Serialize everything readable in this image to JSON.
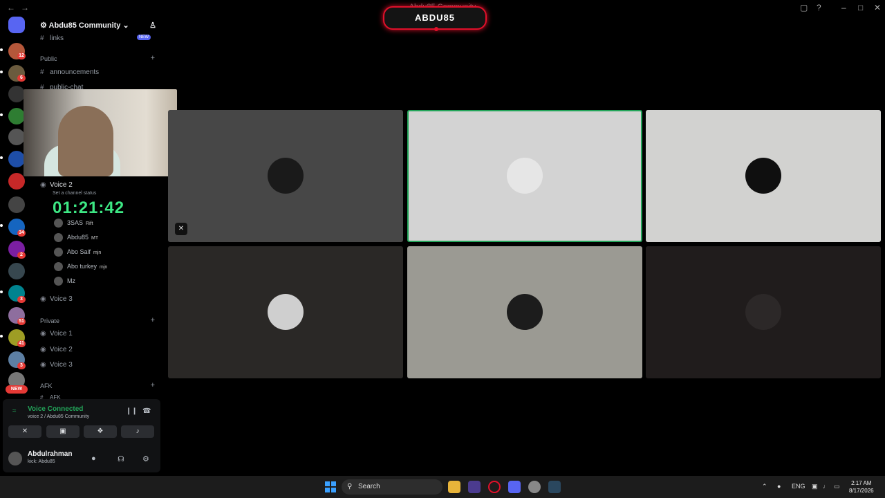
{
  "window": {
    "title": "Abdu85 Community"
  },
  "server": {
    "name": "Abdu85 Community",
    "links_channel": "links",
    "new_badge": "NEW"
  },
  "categories": {
    "public": "Public",
    "private": "Private",
    "afk": "AFK"
  },
  "channels": {
    "announcements": "announcements",
    "public_chat": "public-chat",
    "voice2_public": "Voice 2",
    "voice2_status": "Set a channel status",
    "voice3_public": "Voice 3",
    "private_voice1": "Voice 1",
    "private_voice2": "Voice 2",
    "private_voice3": "Voice 3",
    "afk_channel": "AFK"
  },
  "voice_users": [
    {
      "name": "3SAS",
      "tag": "Rift"
    },
    {
      "name": "Abdu85",
      "tag": "MT"
    },
    {
      "name": "Abo Saif",
      "tag": "mjn"
    },
    {
      "name": "Abo turkey",
      "tag": "mjn"
    },
    {
      "name": "Mz",
      "tag": ""
    }
  ],
  "overlay": {
    "timer": "01:21:42",
    "banner": "ABDU85"
  },
  "server_badges": [
    "12",
    "6",
    "34",
    "2",
    "3",
    "51",
    "41",
    "3"
  ],
  "voice_panel": {
    "status": "Voice Connected",
    "channel": "voice 2 / Abdu85 Community"
  },
  "account": {
    "name": "Abdulrahman",
    "status": "kick: Abdu85"
  },
  "taskbar": {
    "search_placeholder": "Search",
    "lang": "ENG",
    "time": "2:17 AM",
    "date": "8/17/2026"
  },
  "colors": {
    "accent_green": "#23a55a",
    "timer_green": "#3de884",
    "banner_red": "#e0102a"
  }
}
